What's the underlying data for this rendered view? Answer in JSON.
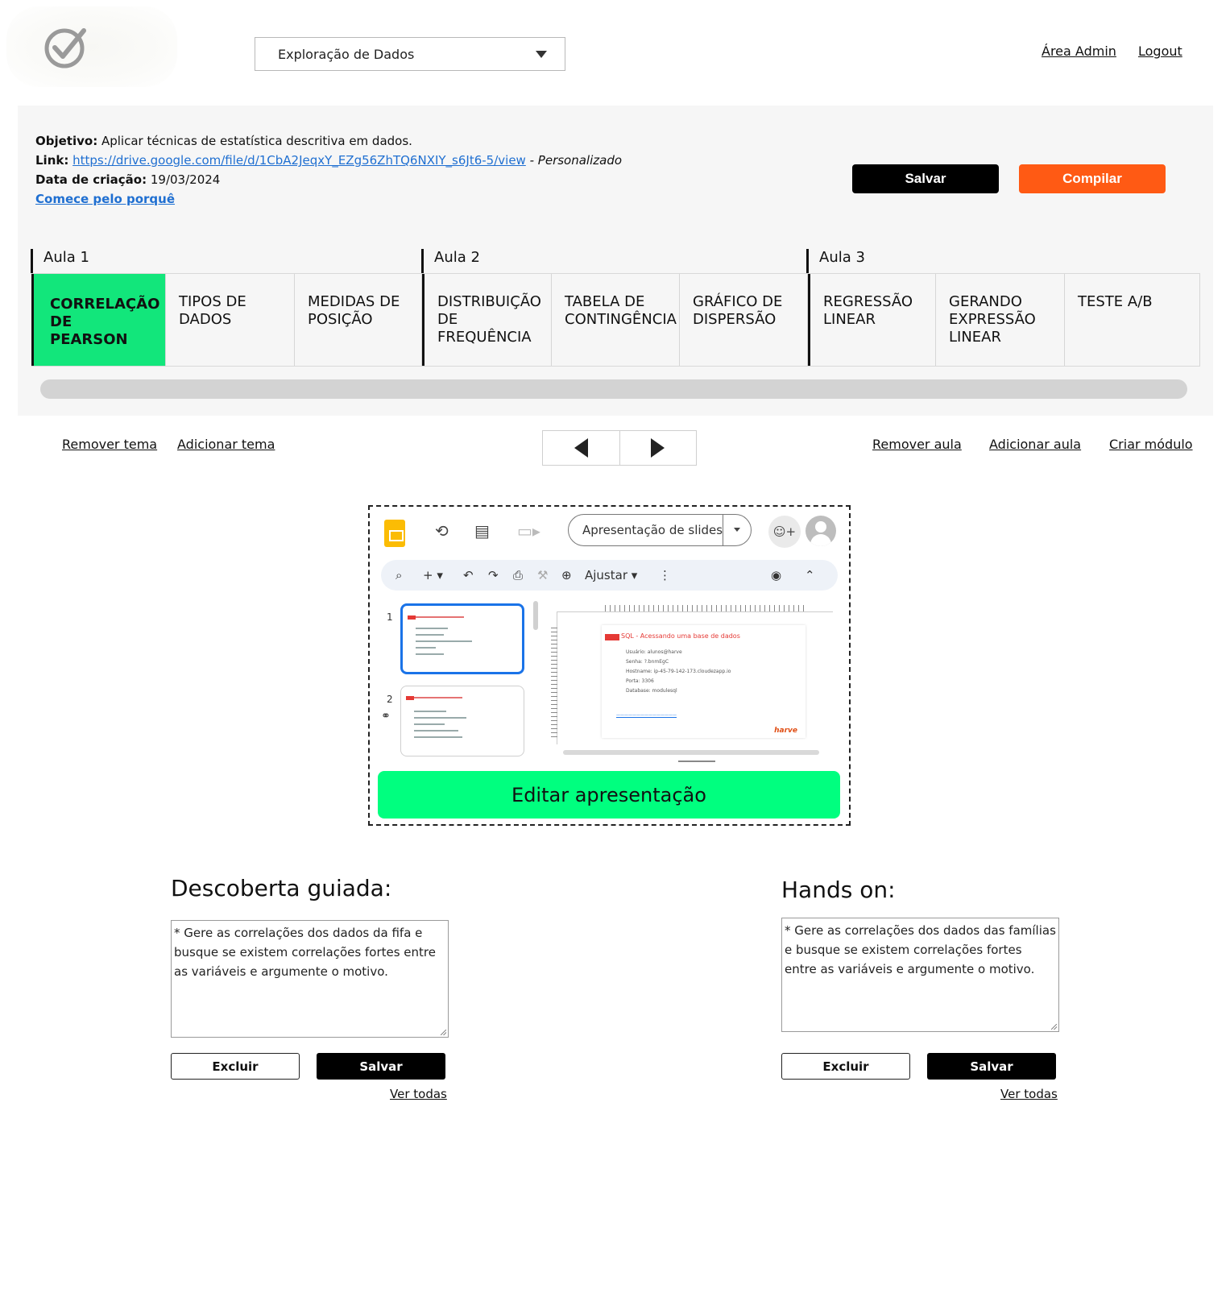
{
  "header": {
    "module_select": "Exploração de Dados",
    "admin_link": "Área Admin",
    "logout_link": "Logout"
  },
  "info": {
    "objective_label": "Objetivo:",
    "objective_text": "Aplicar técnicas de estatística descritiva em dados.",
    "link_label": "Link:",
    "link_url": "https://drive.google.com/file/d/1CbA2JeqxY_EZg56ZhTQ6NXIY_s6Jt6-5/view",
    "link_suffix": "- Personalizado",
    "date_label": "Data de criação:",
    "date_value": "19/03/2024",
    "why_link": "Comece pelo porquê"
  },
  "actions": {
    "save": "Salvar",
    "compile": "Compilar"
  },
  "lessons": [
    {
      "label": "Aula 1"
    },
    {
      "label": "Aula 2"
    },
    {
      "label": "Aula 3"
    }
  ],
  "topics": [
    "CORRELAÇÃO DE PEARSON",
    "TIPOS DE DADOS",
    "MEDIDAS DE POSIÇÃO",
    "DISTRIBUIÇÃO DE FREQUÊNCIA",
    "TABELA DE CONTINGÊNCIA",
    "GRÁFICO DE DISPERSÃO",
    "REGRESSÃO LINEAR",
    "GERANDO EXPRESSÃO LINEAR",
    "TESTE A/B"
  ],
  "nav": {
    "remove_topic": "Remover tema",
    "add_topic": "Adicionar tema",
    "remove_lesson": "Remover aula",
    "add_lesson": "Adicionar aula",
    "create_module": "Criar módulo"
  },
  "preview": {
    "present_button": "Apresentação de slides",
    "zoom_label": "Ajustar",
    "thumb_numbers": [
      "1",
      "2"
    ],
    "slide_title": "SQL - Acessando uma base de dados",
    "slide_lines": [
      "Usuário: alunos@harve",
      "Senha: ?.bnmEgC",
      "Hostname: ip-45-79-142-173.cloudezapp.io",
      "Porta: 3306",
      "Database: modulesql"
    ],
    "slide_brand": "harve",
    "edit_button": "Editar apresentação"
  },
  "guided": {
    "title": "Descoberta guiada:",
    "text": "* Gere as correlações dos dados da fifa e busque se existem correlações fortes entre as variáveis e argumente o motivo.",
    "delete": "Excluir",
    "save": "Salvar",
    "see_all": "Ver todas"
  },
  "hands_on": {
    "title": "Hands on:",
    "text": "* Gere as correlações dos dados das famílias e busque se existem correlações fortes entre as variáveis e argumente o motivo.",
    "delete": "Excluir",
    "save": "Salvar",
    "see_all": "Ver todas"
  },
  "icons": {
    "logo": "check-circle-icon",
    "module_caret": "triangle-down-icon",
    "prev": "triangle-left-icon",
    "next": "triangle-right-icon"
  },
  "colors": {
    "active_topic": "#12e67b",
    "compile": "#ff5a14",
    "edit_button": "#00ff7f",
    "link": "#1f6fd1"
  }
}
